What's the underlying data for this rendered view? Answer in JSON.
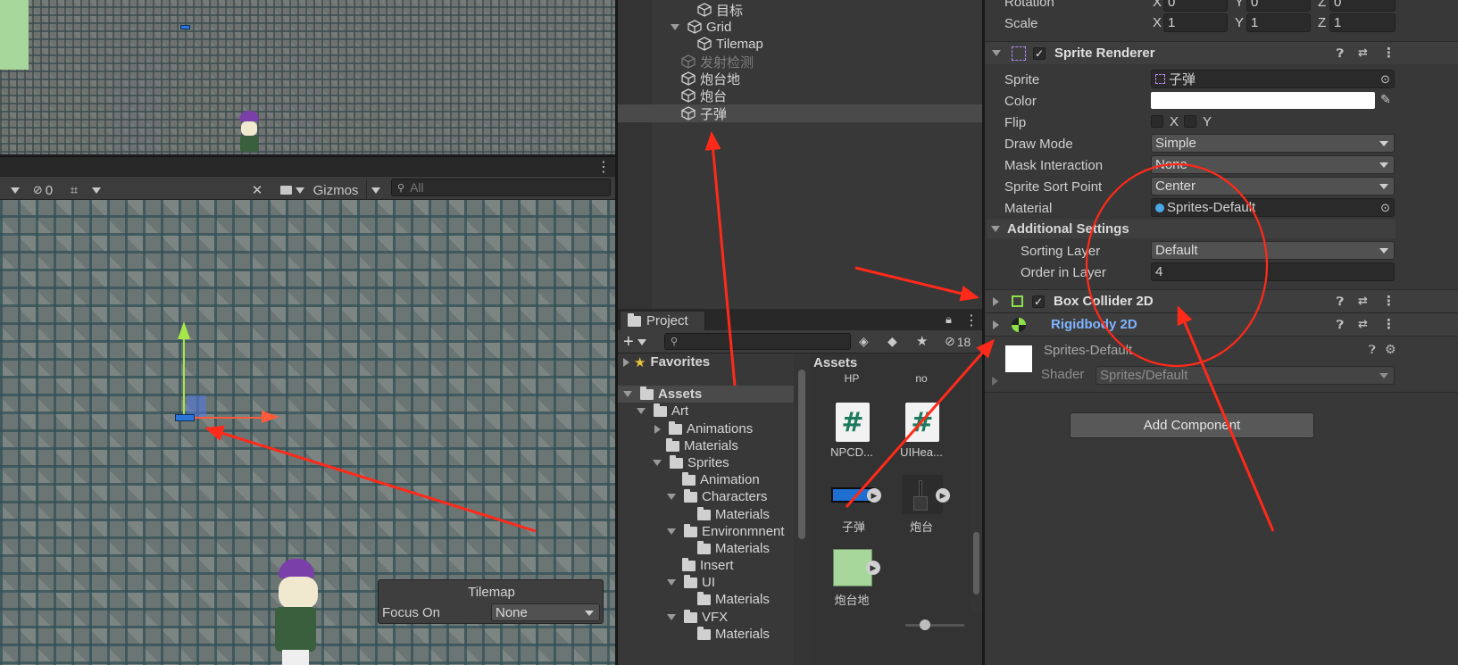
{
  "scene_toolbar": {
    "hidden_count": "0",
    "gizmos_label": "Gizmos",
    "search_placeholder": "All"
  },
  "tilemap_overlay": {
    "title": "Tilemap",
    "focus_label": "Focus On",
    "focus_value": "None"
  },
  "hierarchy": {
    "items": [
      {
        "label": "目标"
      },
      {
        "label": "Grid"
      },
      {
        "label": "Tilemap"
      },
      {
        "label": "发射检测"
      },
      {
        "label": "炮台地"
      },
      {
        "label": "炮台"
      },
      {
        "label": "子弹"
      }
    ]
  },
  "project": {
    "tab_label": "Project",
    "hidden_count": "18",
    "tree": [
      {
        "label": "Favorites"
      },
      {
        "label": "Assets"
      },
      {
        "label": "Art"
      },
      {
        "label": "Animations"
      },
      {
        "label": "Materials"
      },
      {
        "label": "Sprites"
      },
      {
        "label": "Animation"
      },
      {
        "label": "Characters"
      },
      {
        "label": "Materials"
      },
      {
        "label": "Environmnent"
      },
      {
        "label": "Materials"
      },
      {
        "label": "Insert"
      },
      {
        "label": "UI"
      },
      {
        "label": "Materials"
      },
      {
        "label": "VFX"
      },
      {
        "label": "Materials"
      }
    ],
    "assets_header": "Assets",
    "grid": {
      "top_labels": [
        "HP",
        "no"
      ],
      "items": [
        {
          "label": "NPCD...",
          "icon": "script-icon"
        },
        {
          "label": "UIHea...",
          "icon": "script-icon"
        },
        {
          "label": "子弹",
          "icon": "prefab-icon"
        },
        {
          "label": "炮台",
          "icon": "prefab-icon"
        },
        {
          "label": "炮台地",
          "icon": "prefab-icon"
        }
      ]
    }
  },
  "inspector": {
    "transform": {
      "rotation_label": "Rotation",
      "rotation": {
        "x": "0",
        "y": "0",
        "z": "0"
      },
      "scale_label": "Scale",
      "scale": {
        "x": "1",
        "y": "1",
        "z": "1"
      },
      "axis_x": "X",
      "axis_y": "Y",
      "axis_z": "Z"
    },
    "sprite_renderer": {
      "title": "Sprite Renderer",
      "sprite_label": "Sprite",
      "sprite_value": "子弹",
      "color_label": "Color",
      "flip_label": "Flip",
      "flip_x": "X",
      "flip_y": "Y",
      "draw_mode_label": "Draw Mode",
      "draw_mode_value": "Simple",
      "mask_label": "Mask Interaction",
      "mask_value": "None",
      "sort_point_label": "Sprite Sort Point",
      "sort_point_value": "Center",
      "material_label": "Material",
      "material_value": "Sprites-Default",
      "additional_settings": "Additional Settings",
      "sorting_layer_label": "Sorting Layer",
      "sorting_layer_value": "Default",
      "order_label": "Order in Layer",
      "order_value": "4"
    },
    "box_collider": {
      "title": "Box Collider 2D"
    },
    "rigidbody": {
      "title": "Rigidbody 2D"
    },
    "material_block": {
      "name": "Sprites-Default",
      "shader_label": "Shader",
      "shader_value": "Sprites/Default"
    },
    "add_component": "Add Component"
  },
  "colors": {
    "annotation_red": "#ff2a1a",
    "selection_blue": "#2c5d87",
    "link_blue": "#7fb3ff",
    "gizmo_green": "#a6e64a",
    "gizmo_red": "#ff5a3a"
  }
}
